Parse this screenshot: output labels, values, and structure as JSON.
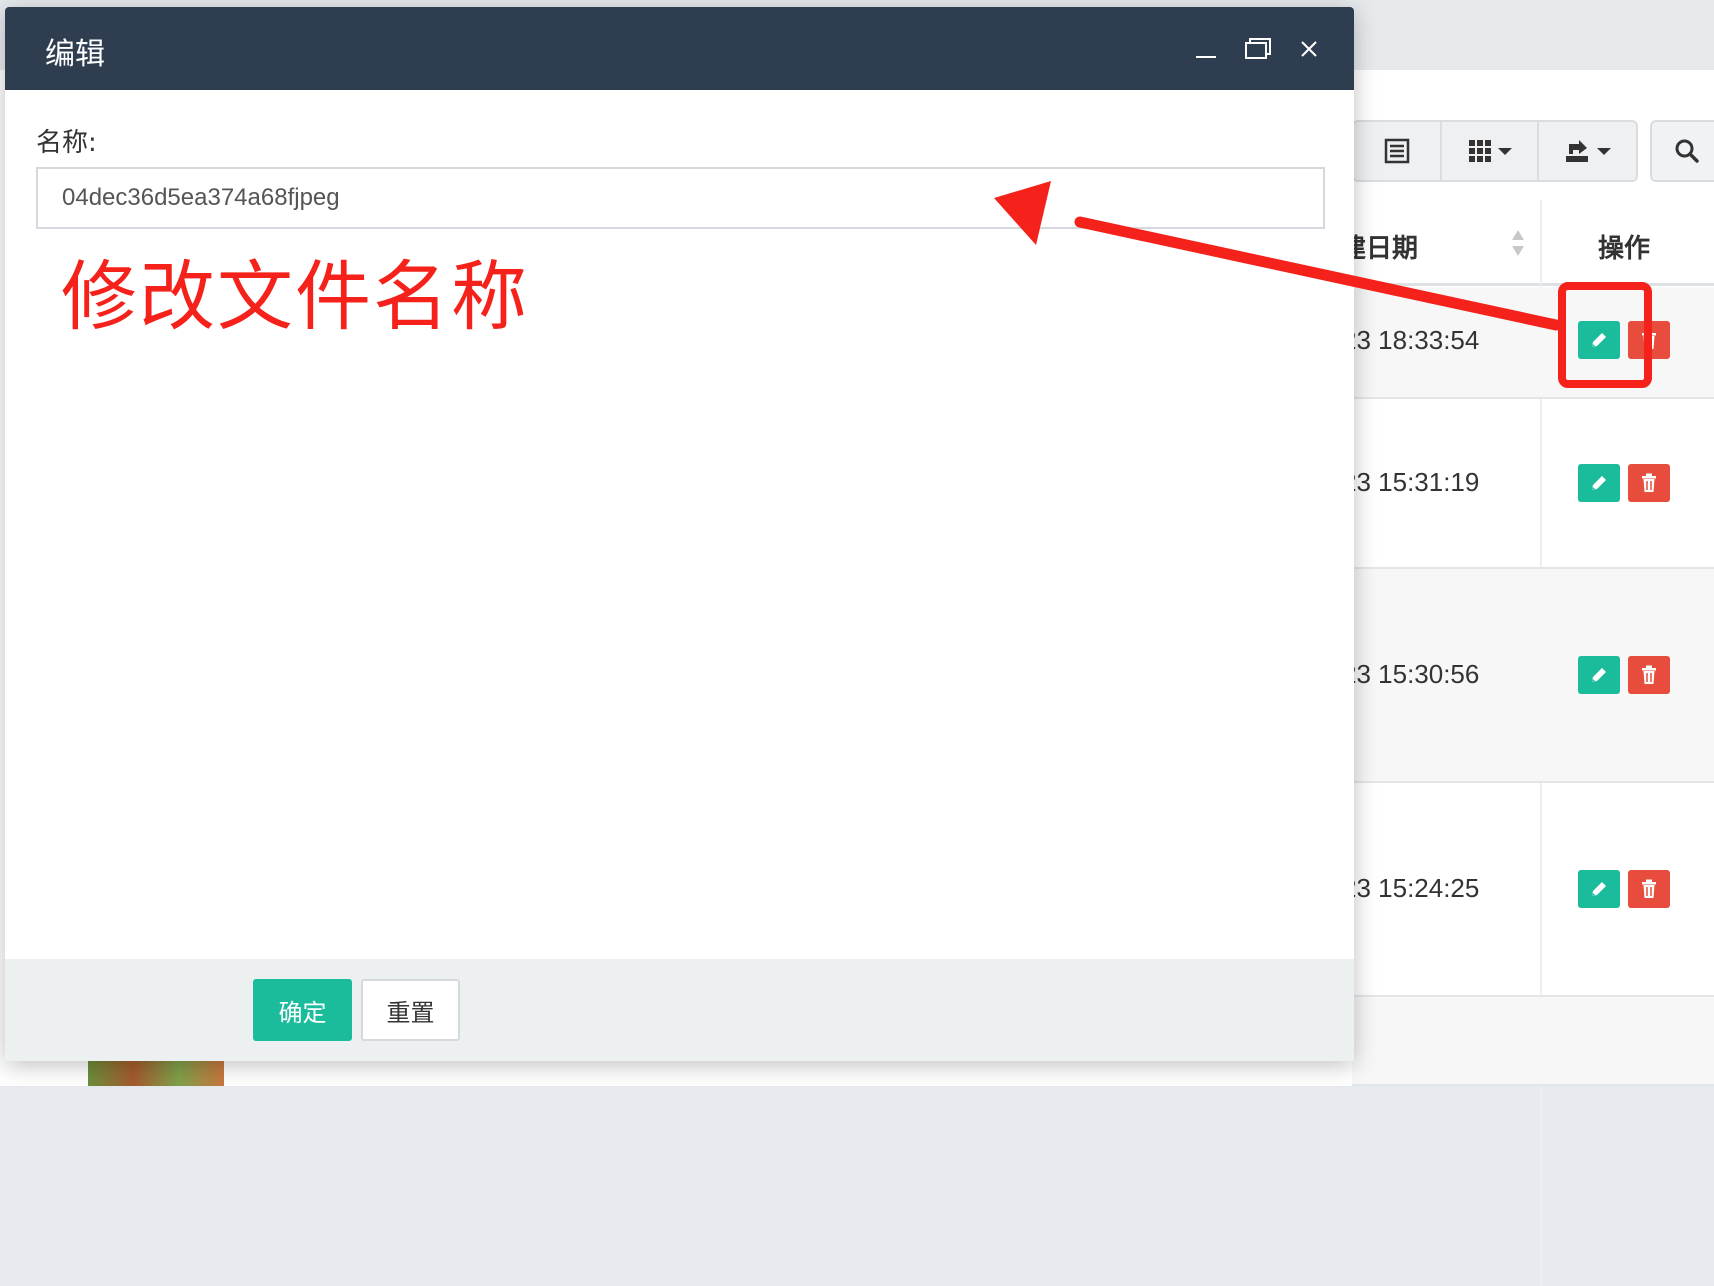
{
  "dialog": {
    "title": "编辑",
    "field_label": "名称:",
    "name_value": "04dec36d5ea374a68fjpeg",
    "confirm_label": "确定",
    "reset_label": "重置"
  },
  "annotation": {
    "text": "修改文件名称",
    "color": "#f5221b"
  },
  "table": {
    "header_date": "建日期",
    "header_action": "操作",
    "rows": [
      {
        "date": "23 18:33:54"
      },
      {
        "date": "23 15:31:19"
      },
      {
        "date": "23 15:30:56"
      },
      {
        "date": "23 15:24:25"
      }
    ]
  },
  "colors": {
    "header_bg": "#2e3e50",
    "primary": "#1abc9c",
    "danger": "#e74c3c"
  },
  "icons": {
    "toolbar": [
      "list-icon",
      "columns-grid-icon",
      "export-icon",
      "search-icon"
    ],
    "row_actions": [
      "pencil-icon",
      "trash-icon"
    ],
    "window": [
      "minimize-icon",
      "maximize-icon",
      "close-icon"
    ]
  }
}
